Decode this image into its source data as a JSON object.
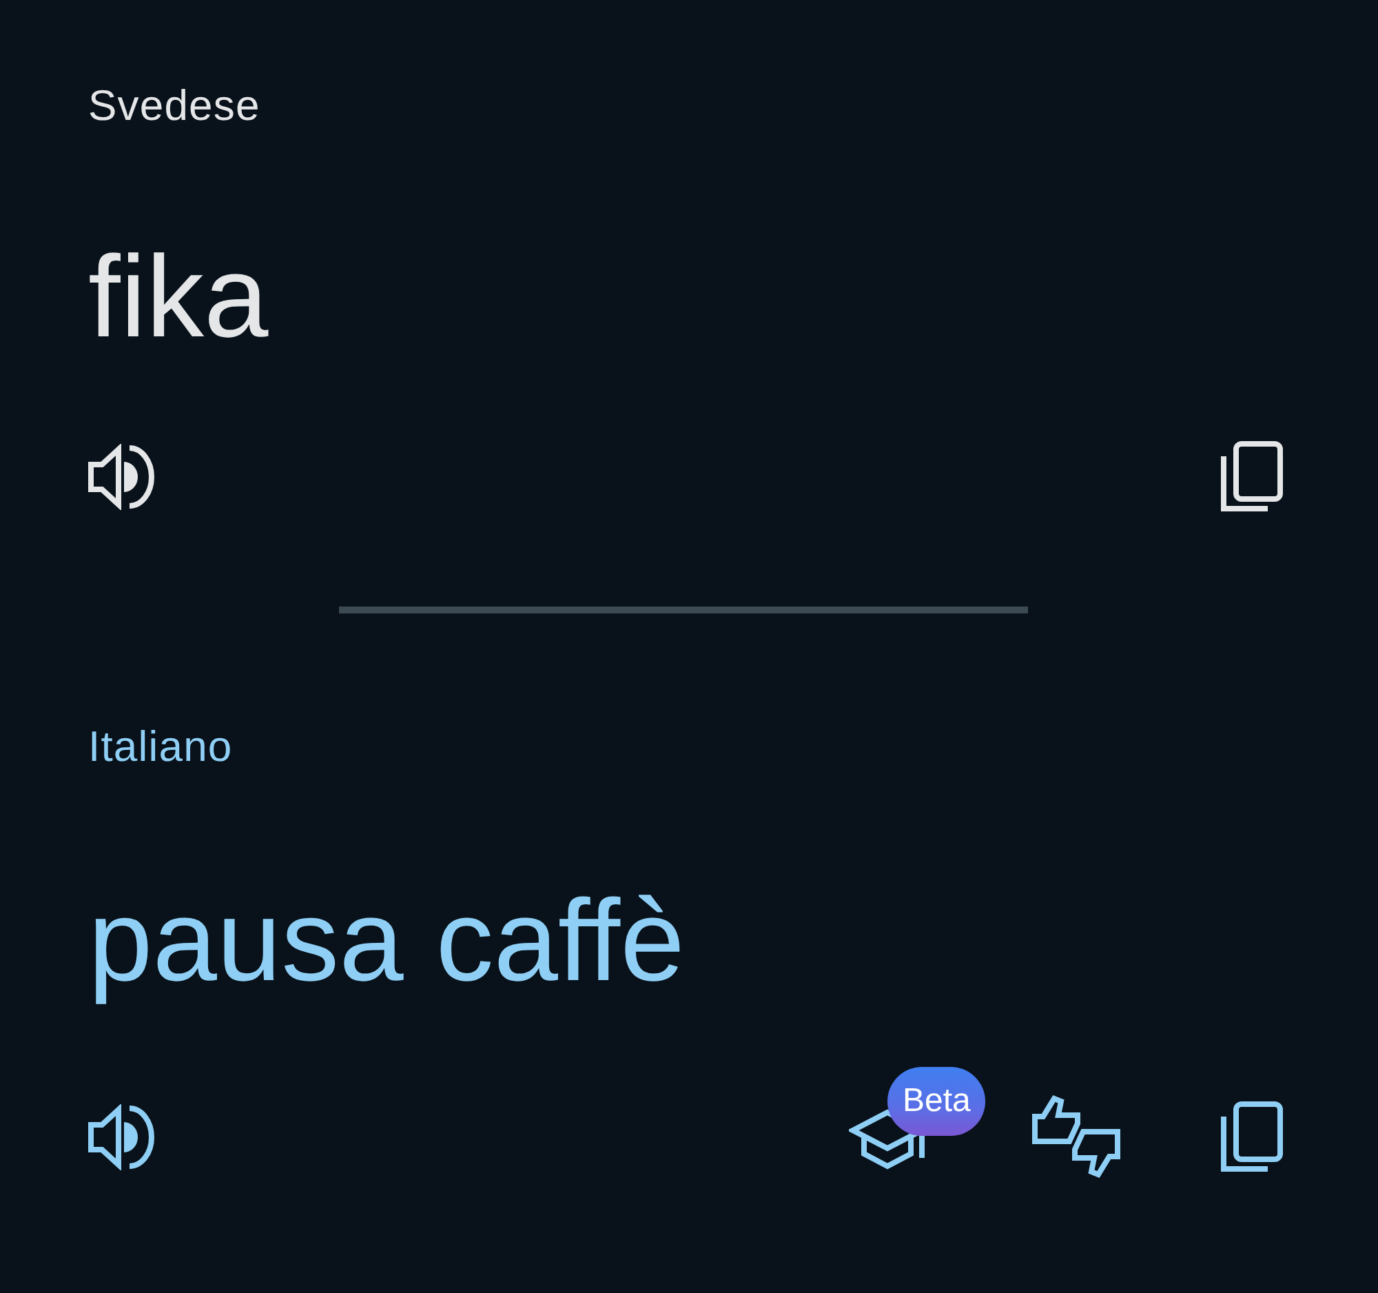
{
  "panels": [
    {
      "kind": "source",
      "language": "Svedese",
      "text": "fika"
    },
    {
      "kind": "target",
      "language": "Italiano",
      "text": "pausa caffè",
      "badge": "Beta"
    }
  ]
}
